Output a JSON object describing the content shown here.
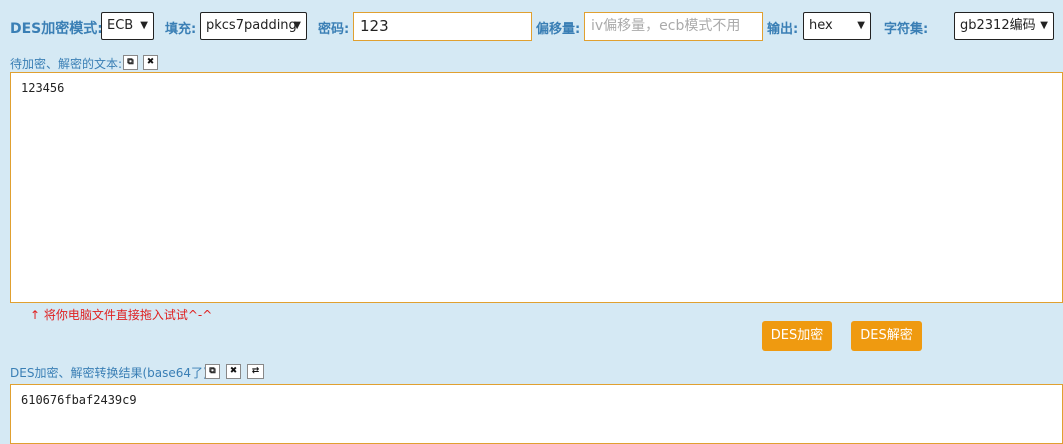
{
  "toolbar": {
    "mode_label": "DES加密模式:",
    "mode_value": "ECB",
    "padding_label": "填充:",
    "padding_value": "pkcs7padding",
    "password_label": "密码:",
    "password_value": "123",
    "iv_label": "偏移量:",
    "iv_placeholder": "iv偏移量，ecb模式不用",
    "output_label": "输出:",
    "output_value": "hex",
    "charset_label": "字符集:",
    "charset_value": "gb2312编码"
  },
  "input_section": {
    "label": "待加密、解密的文本:",
    "copy_icon": "copy-icon",
    "clear_icon": "close-icon",
    "text": "123456",
    "hint": "↑ 将你电脑文件直接拖入试试^-^"
  },
  "actions": {
    "encrypt_label": "DES加密",
    "decrypt_label": "DES解密",
    "accent_color": "#ef9a10"
  },
  "output_section": {
    "label": "DES加密、解密转换结果(base64了):",
    "copy_icon": "copy-icon",
    "clear_icon": "close-icon",
    "swap_icon": "swap-icon",
    "text": "610676fbaf2439c9"
  }
}
